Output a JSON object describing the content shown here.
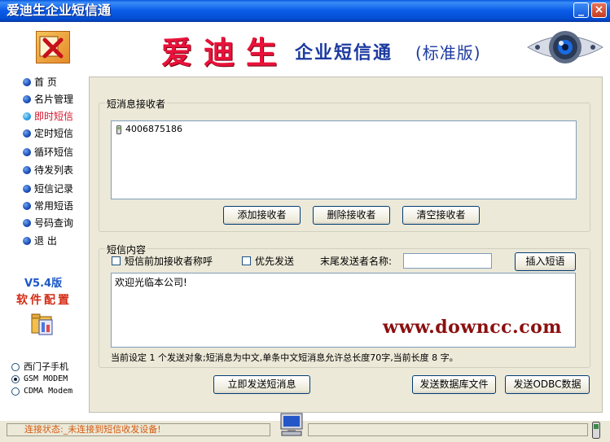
{
  "window": {
    "title": "爱迪生企业短信通"
  },
  "banner": {
    "brand": "爱迪生",
    "product": "企业短信通",
    "edition": "(标准版)"
  },
  "sidebar": {
    "items": [
      {
        "label": "首  页",
        "active": false
      },
      {
        "label": "名片管理",
        "active": false
      },
      {
        "label": "即时短信",
        "active": true
      },
      {
        "label": "定时短信",
        "active": false
      },
      {
        "label": "循环短信",
        "active": false
      },
      {
        "label": "待发列表",
        "active": false
      },
      {
        "label": "短信记录",
        "active": false
      },
      {
        "label": "常用短语",
        "active": false
      },
      {
        "label": "号码查询",
        "active": false
      },
      {
        "label": "退  出",
        "active": false
      }
    ],
    "version": "V5.4版",
    "config_label": "软件配置",
    "devices": [
      {
        "label": "西门子手机",
        "selected": false
      },
      {
        "label": "GSM MODEM",
        "selected": true
      },
      {
        "label": "CDMA Modem",
        "selected": false
      }
    ]
  },
  "recipients": {
    "group_title": "短消息接收者",
    "list": [
      "4006875186"
    ],
    "buttons": {
      "add": "添加接收者",
      "remove": "删除接收者",
      "clear": "清空接收者"
    }
  },
  "message": {
    "group_title": "短信内容",
    "prefix_name_label": "短信前加接收者称呼",
    "priority_label": "优先发送",
    "sender_name_label": "末尾发送者名称:",
    "sender_name_value": "",
    "insert_phrase_button": "插入短语",
    "body": "欢迎光临本公司!",
    "watermark": "www.downcc.com",
    "status": "当前设定 1 个发送对象;短消息为中文,单条中文短消息允许总长度70字,当前长度 8 字。"
  },
  "actions": {
    "send_now": "立即发送短消息",
    "send_db_file": "发送数据库文件",
    "send_odbc": "发送ODBC数据"
  },
  "statusbar": {
    "connection": "连接状态:_未连接到短信收发设备!"
  },
  "colors": {
    "titlebar": "#0a58e0",
    "brand_red": "#e8123a",
    "brand_blue": "#1c3aa0",
    "active_nav": "#d4122a",
    "version_blue": "#1a56c8",
    "status_orange": "#d35a10"
  }
}
